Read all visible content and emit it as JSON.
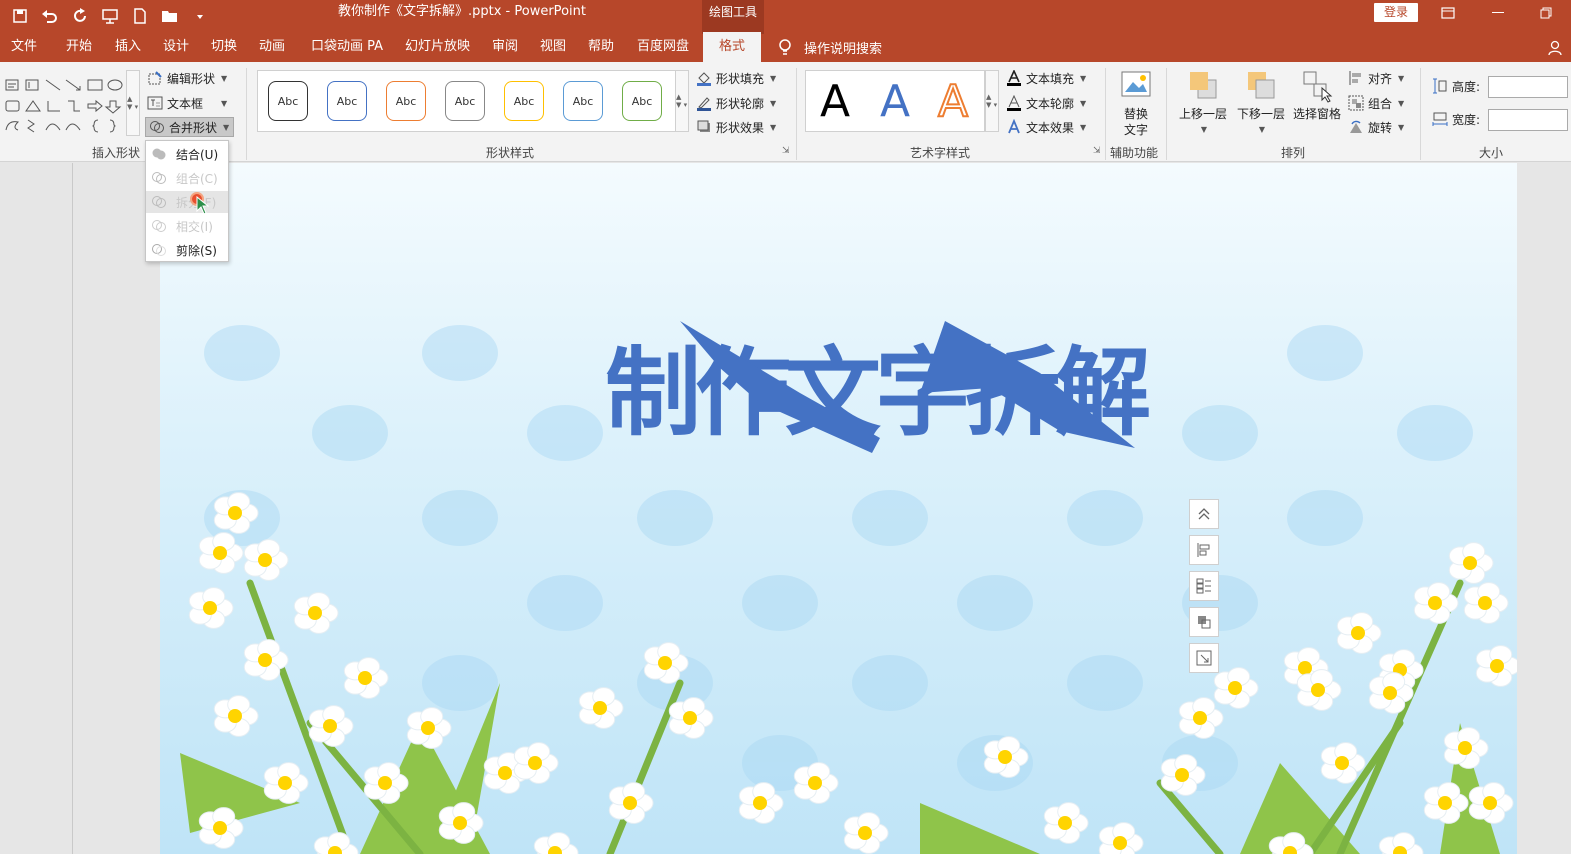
{
  "window": {
    "doc_title": "教你制作《文字拆解》.pptx  -  PowerPoint",
    "context_tool": "绘图工具",
    "login": "登录"
  },
  "tabs": [
    "文件",
    "开始",
    "插入",
    "设计",
    "切换",
    "动画",
    "口袋动画 PA",
    "幻灯片放映",
    "审阅",
    "视图",
    "帮助",
    "百度网盘"
  ],
  "active_tab": "格式",
  "tell_me": "操作说明搜索",
  "ribbon": {
    "insert_shapes": {
      "label": "插入形状",
      "edit_shape": "编辑形状",
      "text_box": "文本框",
      "merge_shapes": "合并形状"
    },
    "shape_styles": {
      "label": "形状样式",
      "abc": "Abc",
      "fill": "形状填充",
      "outline": "形状轮廓",
      "effects": "形状效果",
      "swatches": [
        "#333333",
        "#4472c4",
        "#ed7d31",
        "#888888",
        "#ffc000",
        "#5b9bd5",
        "#70ad47"
      ]
    },
    "wordart": {
      "label": "艺术字样式",
      "letter": "A",
      "text_fill": "文本填充",
      "text_outline": "文本轮廓",
      "text_effects": "文本效果"
    },
    "accessibility": {
      "label": "辅助功能",
      "alt_text_line1": "替换",
      "alt_text_line2": "文字"
    },
    "arrange": {
      "label": "排列",
      "bring_forward": "上移一层",
      "send_backward": "下移一层",
      "selection_pane": "选择窗格",
      "align": "对齐",
      "group": "组合",
      "rotate": "旋转"
    },
    "size": {
      "label": "大小",
      "height": "高度:",
      "width": "宽度:"
    }
  },
  "merge_menu": {
    "items": [
      {
        "label": "结合(U)",
        "enabled": true
      },
      {
        "label": "组合(C)",
        "enabled": false
      },
      {
        "label": "拆分(F)",
        "enabled": false
      },
      {
        "label": "相交(I)",
        "enabled": false
      },
      {
        "label": "剪除(S)",
        "enabled": true
      }
    ]
  },
  "slide": {
    "title": "制作文字拆解",
    "title_color": "#4472c4"
  },
  "colors": {
    "accent": "#b7472a",
    "accent_dark": "#9c3921"
  }
}
